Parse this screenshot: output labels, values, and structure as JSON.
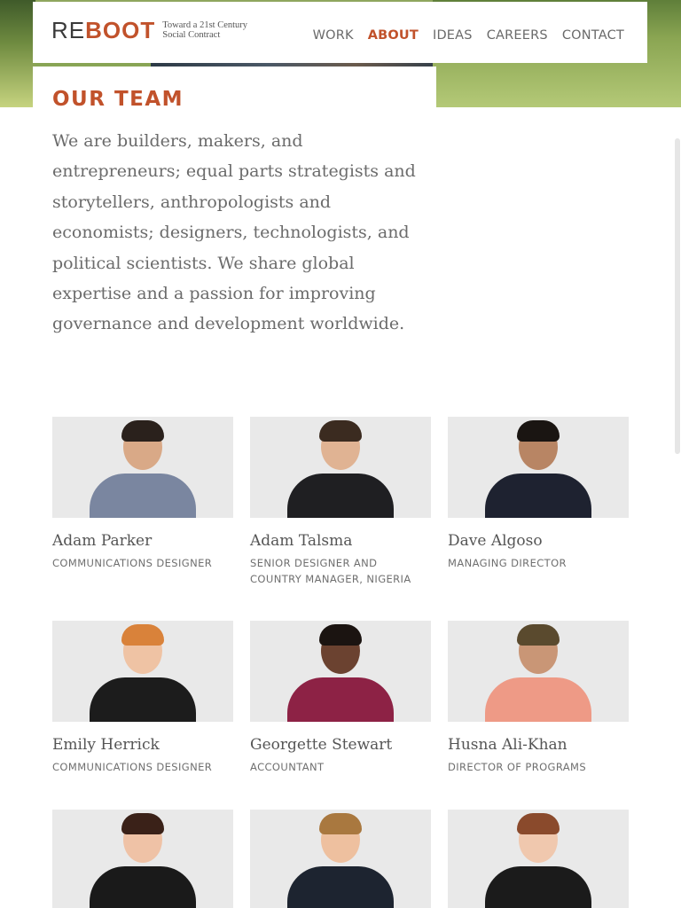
{
  "header": {
    "logo_re": "RE",
    "logo_boot": "BOOT",
    "logo_tagline": "Toward a 21st Century Social Contract",
    "nav": [
      {
        "label": "WORK",
        "active": false
      },
      {
        "label": "ABOUT",
        "active": true
      },
      {
        "label": "IDEAS",
        "active": false
      },
      {
        "label": "CAREERS",
        "active": false
      },
      {
        "label": "CONTACT",
        "active": false
      }
    ]
  },
  "section_title": "OUR TEAM",
  "intro": "We are builders, makers, and entrepreneurs; equal parts strategists and storytellers, anthropologists and economists; designers, technologists, and political scientists. We share global expertise and a passion for improving governance and development worldwide.",
  "colors": {
    "accent": "#c1522b",
    "text": "#6b6b6b",
    "photo_bg": "#e9e9e9"
  },
  "team": [
    {
      "name": "Adam Parker",
      "role": "COMMUNICATIONS DESIGNER"
    },
    {
      "name": "Adam Talsma",
      "role": "SENIOR DESIGNER AND COUNTRY MANAGER, NIGERIA"
    },
    {
      "name": "Dave Algoso",
      "role": "MANAGING DIRECTOR"
    },
    {
      "name": "Emily Herrick",
      "role": "COMMUNICATIONS DESIGNER"
    },
    {
      "name": "Georgette Stewart",
      "role": "ACCOUNTANT"
    },
    {
      "name": "Husna Ali-Khan",
      "role": "DIRECTOR OF PROGRAMS"
    },
    {
      "name": "",
      "role": ""
    },
    {
      "name": "",
      "role": ""
    },
    {
      "name": "",
      "role": ""
    }
  ]
}
